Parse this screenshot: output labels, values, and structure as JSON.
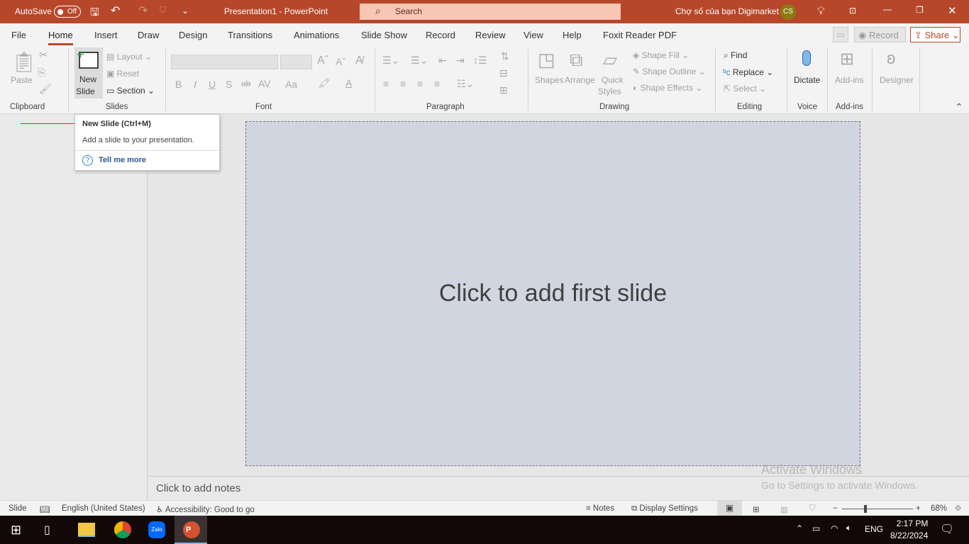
{
  "titlebar": {
    "autosave": "AutoSave",
    "autosave_state": "Off",
    "title": "Presentation1  -  PowerPoint",
    "search_placeholder": "Search",
    "user_name": "Chợ số của bạn Digimarket",
    "user_initials": "CS",
    "accent": "#b7472a"
  },
  "tabs": [
    "File",
    "Home",
    "Insert",
    "Draw",
    "Design",
    "Transitions",
    "Animations",
    "Slide Show",
    "Record",
    "Review",
    "View",
    "Help",
    "Foxit Reader PDF"
  ],
  "tab_actions": {
    "record": "Record",
    "share": "Share"
  },
  "ribbon": {
    "clipboard": {
      "label": "Clipboard",
      "paste": "Paste"
    },
    "slides": {
      "label": "Slides",
      "new_slide_1": "New",
      "new_slide_2": "Slide",
      "layout": "Layout",
      "reset": "Reset",
      "section": "Section"
    },
    "font": {
      "label": "Font",
      "bold": "B",
      "italic": "I",
      "underline": "U",
      "shadow": "S",
      "strike": "ab",
      "spacing": "AV",
      "case": "Aa"
    },
    "paragraph": {
      "label": "Paragraph"
    },
    "drawing": {
      "label": "Drawing",
      "shapes": "Shapes",
      "arrange": "Arrange",
      "quick_1": "Quick",
      "quick_2": "Styles",
      "fill": "Shape Fill",
      "outline": "Shape Outline",
      "effects": "Shape Effects"
    },
    "editing": {
      "label": "Editing",
      "find": "Find",
      "replace": "Replace",
      "select": "Select"
    },
    "voice": {
      "label": "Voice",
      "dictate": "Dictate"
    },
    "addins": {
      "label": "Add-ins",
      "addins": "Add-ins"
    },
    "designer": "Designer"
  },
  "tooltip": {
    "title": "New Slide (Ctrl+M)",
    "desc": "Add a slide to your presentation.",
    "link": "Tell me more"
  },
  "slide": {
    "placeholder": "Click to add first slide"
  },
  "notes": {
    "placeholder": "Click to add notes"
  },
  "watermark": {
    "line1": "Activate Windows",
    "line2": "Go to Settings to activate Windows."
  },
  "status": {
    "slide": "Slide",
    "language": "English (United States)",
    "accessibility": "Accessibility: Good to go",
    "notes": "Notes",
    "display": "Display Settings",
    "zoom": "68%",
    "zoom_percent": 68
  },
  "taskbar": {
    "lang": "ENG",
    "time": "2:17 PM",
    "date": "8/22/2024",
    "apps": [
      "file-explorer",
      "chrome",
      "zalo",
      "powerpoint"
    ]
  }
}
